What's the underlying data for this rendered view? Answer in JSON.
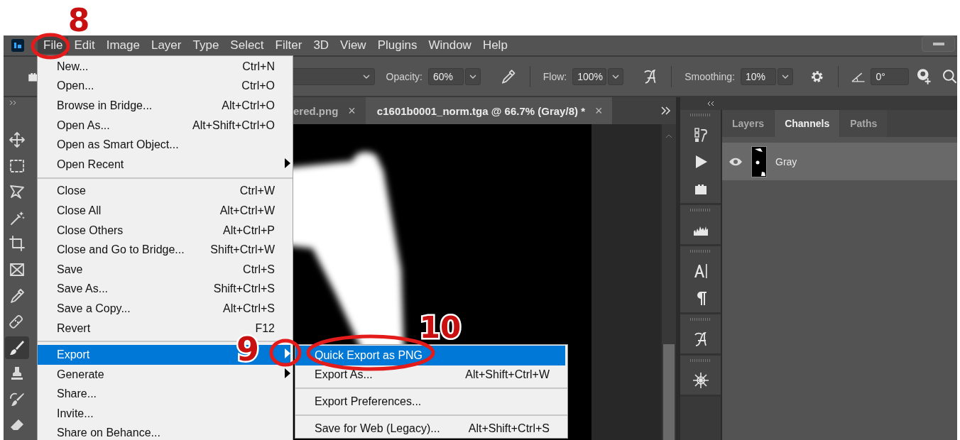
{
  "menu_bar": {
    "items": [
      {
        "label": "File",
        "selected": true
      },
      {
        "label": "Edit",
        "selected": false
      },
      {
        "label": "Image",
        "selected": false
      },
      {
        "label": "Layer",
        "selected": false
      },
      {
        "label": "Type",
        "selected": false
      },
      {
        "label": "Select",
        "selected": false
      },
      {
        "label": "Filter",
        "selected": false
      },
      {
        "label": "3D",
        "selected": false
      },
      {
        "label": "View",
        "selected": false
      },
      {
        "label": "Plugins",
        "selected": false
      },
      {
        "label": "Window",
        "selected": false
      },
      {
        "label": "Help",
        "selected": false
      }
    ]
  },
  "options_bar": {
    "opacity": {
      "label": "Opacity:",
      "value": "60%"
    },
    "flow": {
      "label": "Flow:",
      "value": "100%"
    },
    "smoothing": {
      "label": "Smoothing:",
      "value": "10%"
    },
    "angle": {
      "value": "0°"
    }
  },
  "tools": [
    {
      "kind": "move",
      "selected": false
    },
    {
      "kind": "marquee",
      "selected": false
    },
    {
      "kind": "lasso",
      "selected": false
    },
    {
      "kind": "wand",
      "selected": false
    },
    {
      "kind": "crop",
      "selected": false
    },
    {
      "kind": "frame",
      "selected": false
    },
    {
      "kind": "eyedropper",
      "selected": false
    },
    {
      "kind": "bandage",
      "selected": false
    },
    {
      "kind": "brush",
      "selected": true
    },
    {
      "kind": "stamp",
      "selected": false
    },
    {
      "kind": "history-brush",
      "selected": false
    },
    {
      "kind": "eraser",
      "selected": false
    }
  ],
  "document_tabs": [
    {
      "title": "ered.png",
      "close": "×",
      "selected": false
    },
    {
      "title": "c1601b0001_norm.tga @ 66.7% (Gray/8) *",
      "close": "×",
      "selected": true
    }
  ],
  "dock_groups": [
    {
      "icons": [
        {
          "kind": "history"
        },
        {
          "kind": "play"
        },
        {
          "kind": "brick"
        }
      ]
    },
    {
      "icons": [
        {
          "kind": "histogram"
        }
      ]
    },
    {
      "icons": [
        {
          "kind": "character"
        },
        {
          "kind": "paragraph"
        }
      ]
    },
    {
      "icons": [
        {
          "kind": "glyphs"
        }
      ]
    },
    {
      "icons": [
        {
          "kind": "helm"
        }
      ]
    }
  ],
  "panel": {
    "tabs": [
      {
        "label": "Layers",
        "selected": false
      },
      {
        "label": "Channels",
        "selected": true
      },
      {
        "label": "Paths",
        "selected": false
      }
    ],
    "channels": [
      {
        "name": "Gray",
        "visible": true,
        "selected": true
      }
    ]
  },
  "file_menu": {
    "items": [
      {
        "kind": "item",
        "label": "New...",
        "shortcut": "Ctrl+N",
        "submenu": false,
        "selected": false
      },
      {
        "kind": "item",
        "label": "Open...",
        "shortcut": "Ctrl+O",
        "submenu": false,
        "selected": false
      },
      {
        "kind": "item",
        "label": "Browse in Bridge...",
        "shortcut": "Alt+Ctrl+O",
        "submenu": false,
        "selected": false
      },
      {
        "kind": "item",
        "label": "Open As...",
        "shortcut": "Alt+Shift+Ctrl+O",
        "submenu": false,
        "selected": false
      },
      {
        "kind": "item",
        "label": "Open as Smart Object...",
        "submenu": false,
        "selected": false
      },
      {
        "kind": "item",
        "label": "Open Recent",
        "submenu": true,
        "selected": false
      },
      {
        "kind": "separator"
      },
      {
        "kind": "item",
        "label": "Close",
        "shortcut": "Ctrl+W",
        "submenu": false,
        "selected": false
      },
      {
        "kind": "item",
        "label": "Close All",
        "shortcut": "Alt+Ctrl+W",
        "submenu": false,
        "selected": false
      },
      {
        "kind": "item",
        "label": "Close Others",
        "shortcut": "Alt+Ctrl+P",
        "submenu": false,
        "selected": false
      },
      {
        "kind": "item",
        "label": "Close and Go to Bridge...",
        "shortcut": "Shift+Ctrl+W",
        "submenu": false,
        "selected": false
      },
      {
        "kind": "item",
        "label": "Save",
        "shortcut": "Ctrl+S",
        "submenu": false,
        "selected": false
      },
      {
        "kind": "item",
        "label": "Save As...",
        "shortcut": "Shift+Ctrl+S",
        "submenu": false,
        "selected": false
      },
      {
        "kind": "item",
        "label": "Save a Copy...",
        "shortcut": "Alt+Ctrl+S",
        "submenu": false,
        "selected": false
      },
      {
        "kind": "item",
        "label": "Revert",
        "shortcut": "F12",
        "submenu": false,
        "selected": false
      },
      {
        "kind": "separator"
      },
      {
        "kind": "item",
        "label": "Export",
        "submenu": true,
        "selected": true
      },
      {
        "kind": "item",
        "label": "Generate",
        "submenu": true,
        "selected": false
      },
      {
        "kind": "item",
        "label": "Share...",
        "submenu": false,
        "selected": false
      },
      {
        "kind": "item",
        "label": "Invite...",
        "submenu": false,
        "selected": false
      },
      {
        "kind": "item",
        "label": "Share on Behance...",
        "submenu": false,
        "selected": false
      }
    ]
  },
  "export_submenu": {
    "items": [
      {
        "kind": "item",
        "label": "Quick Export as PNG",
        "submenu": false,
        "selected": true
      },
      {
        "kind": "item",
        "label": "Export As...",
        "shortcut": "Alt+Shift+Ctrl+W",
        "submenu": false,
        "selected": false
      },
      {
        "kind": "separator"
      },
      {
        "kind": "item",
        "label": "Export Preferences...",
        "submenu": false,
        "selected": false
      },
      {
        "kind": "separator"
      },
      {
        "kind": "item",
        "label": "Save for Web (Legacy)...",
        "shortcut": "Alt+Shift+Ctrl+S",
        "submenu": false,
        "selected": false
      }
    ]
  },
  "annotations": [
    {
      "label": "8"
    },
    {
      "label": "9"
    },
    {
      "label": "10"
    }
  ]
}
